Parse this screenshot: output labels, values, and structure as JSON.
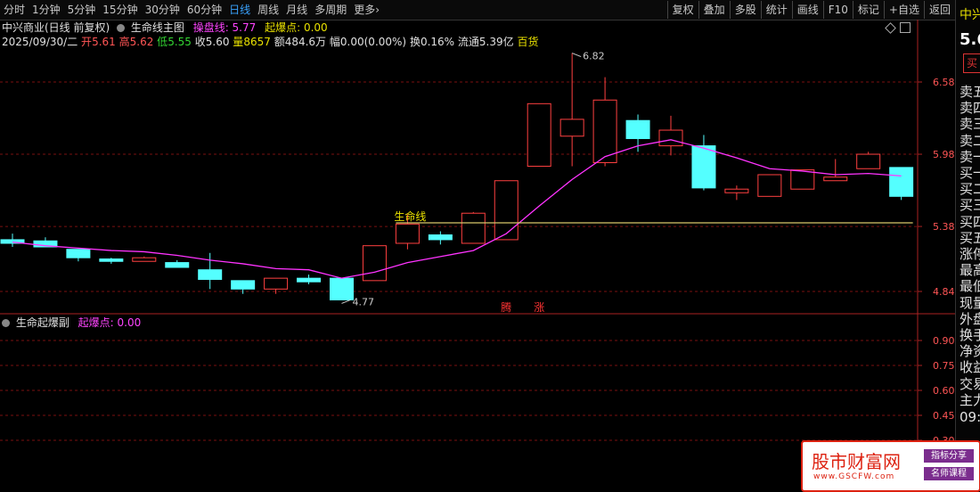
{
  "toolbar": {
    "periods": [
      "分时",
      "1分钟",
      "5分钟",
      "15分钟",
      "30分钟",
      "60分钟",
      "日线",
      "周线",
      "月线",
      "多周期",
      "更多›"
    ],
    "active_period": "日线",
    "tools": [
      "复权",
      "叠加",
      "多股",
      "统计",
      "画线",
      "F10",
      "标记",
      "+自选",
      "返回"
    ]
  },
  "info": {
    "stock_name": "中兴商业(日线 前复权)",
    "indicator_name": "生命线主图",
    "param1_label": "操盘线: ",
    "param1_value": "5.77",
    "param2_label": "起爆点: ",
    "param2_value": "0.00",
    "date": "2025/09/30/二",
    "open_label": "开",
    "open": "5.61",
    "high_label": "高",
    "high": "5.62",
    "low_label": "低",
    "low": "5.55",
    "close_label": "收",
    "close": "5.60",
    "volume_label": "量",
    "volume": "8657",
    "amount_label": "额",
    "amount": "484.6万",
    "change_label": "幅",
    "change": "0.00(0.00%)",
    "turnover_label": "换",
    "turnover": "0.16%",
    "float_label": "流通",
    "float_cap": "5.39亿",
    "sector": "百货"
  },
  "sub_panel": {
    "name": "生命起爆副",
    "param_label": "起爆点: ",
    "param_value": "0.00"
  },
  "sidebar": {
    "title": "中兴",
    "price": "5.6",
    "button": "买",
    "rows": [
      "卖五",
      "卖四",
      "卖三",
      "卖二",
      "卖一",
      "买一",
      "买二",
      "买三",
      "买四",
      "买五",
      "涨停",
      "最高",
      "最低",
      "现量",
      "外盘",
      "换手",
      "净资",
      "收益",
      "交易",
      "主力"
    ],
    "time": "09:4"
  },
  "logo": {
    "main_text": "股市财富网",
    "url": "www.GSCFW.com",
    "tag1": "指标分享",
    "tag2": "名师课程"
  },
  "chart_data": {
    "type": "candlestick",
    "main_axis": {
      "ticks": [
        6.58,
        5.98,
        5.38,
        4.84
      ]
    },
    "candles": [
      {
        "o": 5.27,
        "c": 5.24,
        "h": 5.32,
        "l": 5.21
      },
      {
        "o": 5.26,
        "c": 5.21,
        "h": 5.29,
        "l": 5.21
      },
      {
        "o": 5.19,
        "c": 5.12,
        "h": 5.19,
        "l": 5.09
      },
      {
        "o": 5.11,
        "c": 5.09,
        "h": 5.12,
        "l": 5.07
      },
      {
        "o": 5.09,
        "c": 5.12,
        "h": 5.13,
        "l": 5.09
      },
      {
        "o": 5.08,
        "c": 5.04,
        "h": 5.1,
        "l": 5.04
      },
      {
        "o": 5.02,
        "c": 4.94,
        "h": 5.16,
        "l": 4.86
      },
      {
        "o": 4.93,
        "c": 4.86,
        "h": 4.93,
        "l": 4.82
      },
      {
        "o": 4.86,
        "c": 4.95,
        "h": 4.95,
        "l": 4.82
      },
      {
        "o": 4.95,
        "c": 4.92,
        "h": 4.98,
        "l": 4.9
      },
      {
        "o": 4.95,
        "c": 4.77,
        "h": 4.95,
        "l": 4.77
      },
      {
        "o": 4.93,
        "c": 5.22,
        "h": 5.22,
        "l": 4.93
      },
      {
        "o": 5.24,
        "c": 5.4,
        "h": 5.48,
        "l": 5.19
      },
      {
        "o": 5.31,
        "c": 5.27,
        "h": 5.34,
        "l": 5.23
      },
      {
        "o": 5.24,
        "c": 5.49,
        "h": 5.5,
        "l": 5.24
      },
      {
        "o": 5.27,
        "c": 5.76,
        "h": 5.76,
        "l": 5.27
      },
      {
        "o": 5.88,
        "c": 6.4,
        "h": 6.4,
        "l": 5.88
      },
      {
        "o": 6.13,
        "c": 6.27,
        "h": 6.82,
        "l": 5.88
      },
      {
        "o": 5.91,
        "c": 6.43,
        "h": 6.62,
        "l": 5.88
      },
      {
        "o": 6.26,
        "c": 6.11,
        "h": 6.31,
        "l": 6.0
      },
      {
        "o": 6.05,
        "c": 6.18,
        "h": 6.3,
        "l": 5.97
      },
      {
        "o": 6.05,
        "c": 5.7,
        "h": 6.14,
        "l": 5.68
      },
      {
        "o": 5.66,
        "c": 5.69,
        "h": 5.72,
        "l": 5.6
      },
      {
        "o": 5.63,
        "c": 5.81,
        "h": 5.81,
        "l": 5.63
      },
      {
        "o": 5.69,
        "c": 5.85,
        "h": 5.85,
        "l": 5.69
      },
      {
        "o": 5.76,
        "c": 5.79,
        "h": 5.94,
        "l": 5.76
      },
      {
        "o": 5.86,
        "c": 5.98,
        "h": 6.0,
        "l": 5.86
      },
      {
        "o": 5.87,
        "c": 5.63,
        "h": 5.87,
        "l": 5.6
      }
    ],
    "ma_line": [
      5.25,
      5.22,
      5.2,
      5.18,
      5.17,
      5.14,
      5.1,
      5.07,
      5.03,
      5.02,
      4.95,
      5.0,
      5.08,
      5.13,
      5.18,
      5.32,
      5.55,
      5.77,
      5.96,
      6.05,
      6.1,
      6.03,
      5.95,
      5.86,
      5.84,
      5.81,
      5.82,
      5.8
    ],
    "life_line": {
      "label": "生命线",
      "value": 5.41,
      "from_index": 12,
      "to_index": 27
    },
    "annotations": [
      {
        "text": "6.82",
        "index": 17,
        "value": 6.82
      },
      {
        "text": "4.77",
        "index": 10,
        "value": 4.77
      }
    ],
    "markers": [
      {
        "text": "腾",
        "index": 15
      },
      {
        "text": "涨",
        "index": 16
      }
    ],
    "sub_axis": {
      "ticks": [
        0.9,
        0.75,
        0.6,
        0.45,
        0.3
      ]
    }
  }
}
